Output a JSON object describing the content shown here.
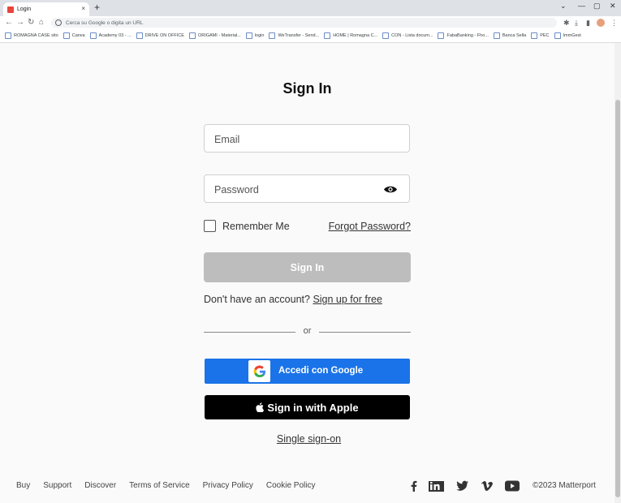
{
  "browser": {
    "tab_title": "Login",
    "new_tab": "+",
    "close_tab": "×",
    "window_controls": [
      "⌄",
      "—",
      "▢",
      "✕"
    ],
    "omnibox_placeholder": "Cerca su Google o digita un URL",
    "bookmarks": [
      "ROMAGNA CASE sito",
      "Canva",
      "Academy 03 - ...",
      "DRIVE ON OFFICE",
      "ORIGAMI - Material...",
      "login",
      "WeTransfer - Send...",
      "HOME | Romagna C...",
      "CON - Lista docum...",
      "FabaBanking - Fho...",
      "Banca Sella",
      "PEC",
      "ImmGest"
    ]
  },
  "login": {
    "title": "Sign In",
    "email_placeholder": "Email",
    "password_placeholder": "Password",
    "remember_label": "Remember Me",
    "forgot_label": "Forgot Password?",
    "signin_button": "Sign In",
    "no_account_text": "Don't have an account?",
    "signup_link": "Sign up for free",
    "or_text": "or",
    "google_button": "Accedi con Google",
    "apple_button": "Sign in with Apple",
    "sso_link": "Single sign-on"
  },
  "footer": {
    "links": [
      "Buy",
      "Support",
      "Discover",
      "Terms of Service",
      "Privacy Policy",
      "Cookie Policy"
    ],
    "copyright": "©2023 Matterport",
    "social_icons": [
      "facebook-icon",
      "linkedin-icon",
      "twitter-icon",
      "vimeo-icon",
      "youtube-icon"
    ]
  },
  "colors": {
    "google_blue": "#1a73e8",
    "apple_black": "#000000",
    "disabled_button": "#bdbdbd"
  }
}
